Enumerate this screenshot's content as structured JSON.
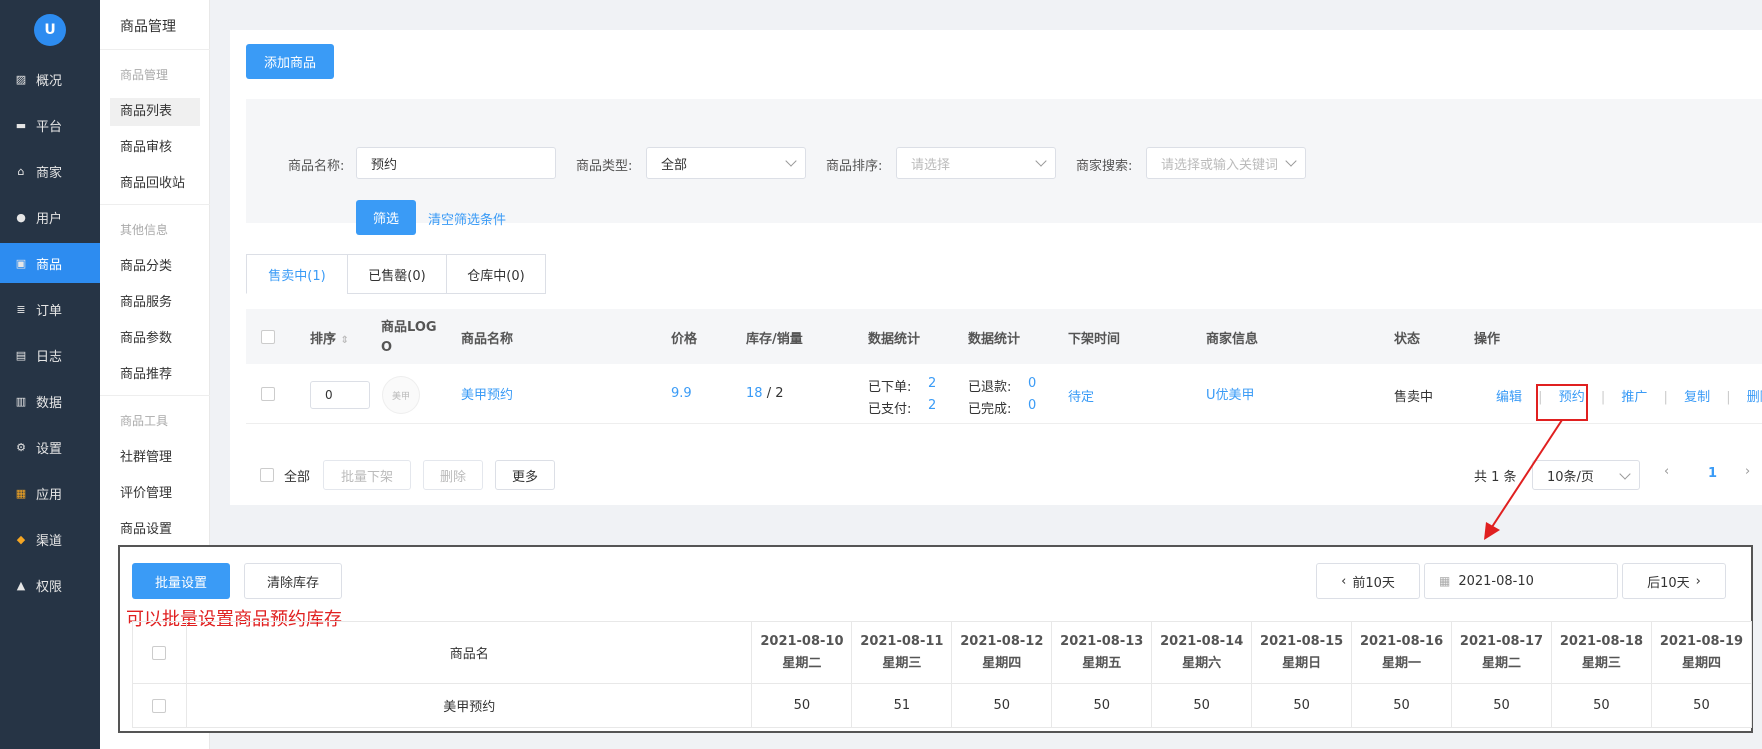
{
  "sidebar": {
    "logo": "U",
    "items": [
      {
        "label": "概况",
        "icon": "chart-icon"
      },
      {
        "label": "平台",
        "icon": "monitor-icon"
      },
      {
        "label": "商家",
        "icon": "store-icon"
      },
      {
        "label": "用户",
        "icon": "user-icon"
      },
      {
        "label": "商品",
        "icon": "bag-icon",
        "active": true
      },
      {
        "label": "订单",
        "icon": "order-icon"
      },
      {
        "label": "日志",
        "icon": "log-icon"
      },
      {
        "label": "数据",
        "icon": "bar-chart-icon"
      },
      {
        "label": "设置",
        "icon": "gear-icon"
      },
      {
        "label": "应用",
        "icon": "apps-icon"
      },
      {
        "label": "渠道",
        "icon": "cube-icon"
      },
      {
        "label": "权限",
        "icon": "lock-icon"
      }
    ]
  },
  "submenu": {
    "title": "商品管理",
    "group1": "商品管理",
    "item1": "商品列表",
    "item2": "商品审核",
    "item3": "商品回收站",
    "group2": "其他信息",
    "item4": "商品分类",
    "item5": "商品服务",
    "item6": "商品参数",
    "item7": "商品推荐",
    "group3": "商品工具",
    "item8": "社群管理",
    "item9": "评价管理",
    "item10": "商品设置"
  },
  "toolbar": {
    "add_label": "添加商品"
  },
  "filter": {
    "name_label": "商品名称:",
    "name_value": "预约",
    "type_label": "商品类型:",
    "type_value": "全部",
    "sort_label": "商品排序:",
    "sort_placeholder": "请选择",
    "merchant_label": "商家搜索:",
    "merchant_placeholder": "请选择或输入关键词",
    "submit": "筛选",
    "clear": "清空筛选条件"
  },
  "tabs": {
    "on_sale": "售卖中(1)",
    "sold_out": "已售罄(0)",
    "in_stock": "仓库中(0)"
  },
  "table": {
    "headers": {
      "sort": "排序",
      "logo": "商品LOGO",
      "name": "商品名称",
      "price": "价格",
      "stock": "库存/销量",
      "stats1": "数据统计",
      "stats2": "数据统计",
      "offline": "下架时间",
      "merchant": "商家信息",
      "status": "状态",
      "actions": "操作"
    },
    "row": {
      "sort": "0",
      "logo_text": "美甲",
      "name": "美甲预约",
      "price": "9.9",
      "stock": "18",
      "sales": "/ 2",
      "ordered_label": "已下单:",
      "ordered": "2",
      "paid_label": "已支付:",
      "paid": "2",
      "refunded_label": "已退款:",
      "refunded": "0",
      "completed_label": "已完成:",
      "completed": "0",
      "offline": "待定",
      "merchant": "U优美甲",
      "status": "售卖中",
      "act_edit": "编辑",
      "act_reserve": "预约",
      "act_promote": "推广",
      "act_copy": "复制",
      "act_delete": "删除"
    }
  },
  "bulk": {
    "all": "全部",
    "off": "批量下架",
    "delete": "删除",
    "more": "更多"
  },
  "pagination": {
    "total": "共 1 条",
    "page_size": "10条/页",
    "current": "1"
  },
  "panel": {
    "batch_set": "批量设置",
    "clear_stock": "清除库存",
    "prev": "前10天",
    "date": "2021-08-10",
    "next": "后10天",
    "annotation": "可以批量设置商品预约库存",
    "name_header": "商品名",
    "days": [
      {
        "date": "2021-08-10",
        "weekday": "星期二",
        "stock": "50"
      },
      {
        "date": "2021-08-11",
        "weekday": "星期三",
        "stock": "51"
      },
      {
        "date": "2021-08-12",
        "weekday": "星期四",
        "stock": "50"
      },
      {
        "date": "2021-08-13",
        "weekday": "星期五",
        "stock": "50"
      },
      {
        "date": "2021-08-14",
        "weekday": "星期六",
        "stock": "50"
      },
      {
        "date": "2021-08-15",
        "weekday": "星期日",
        "stock": "50"
      },
      {
        "date": "2021-08-16",
        "weekday": "星期一",
        "stock": "50"
      },
      {
        "date": "2021-08-17",
        "weekday": "星期二",
        "stock": "50"
      },
      {
        "date": "2021-08-18",
        "weekday": "星期三",
        "stock": "50"
      },
      {
        "date": "2021-08-19",
        "weekday": "星期四",
        "stock": "50"
      }
    ],
    "product": "美甲预约"
  },
  "colors": {
    "primary": "#3a9bf6",
    "sidebar": "#263445",
    "annotation": "#e02020"
  }
}
